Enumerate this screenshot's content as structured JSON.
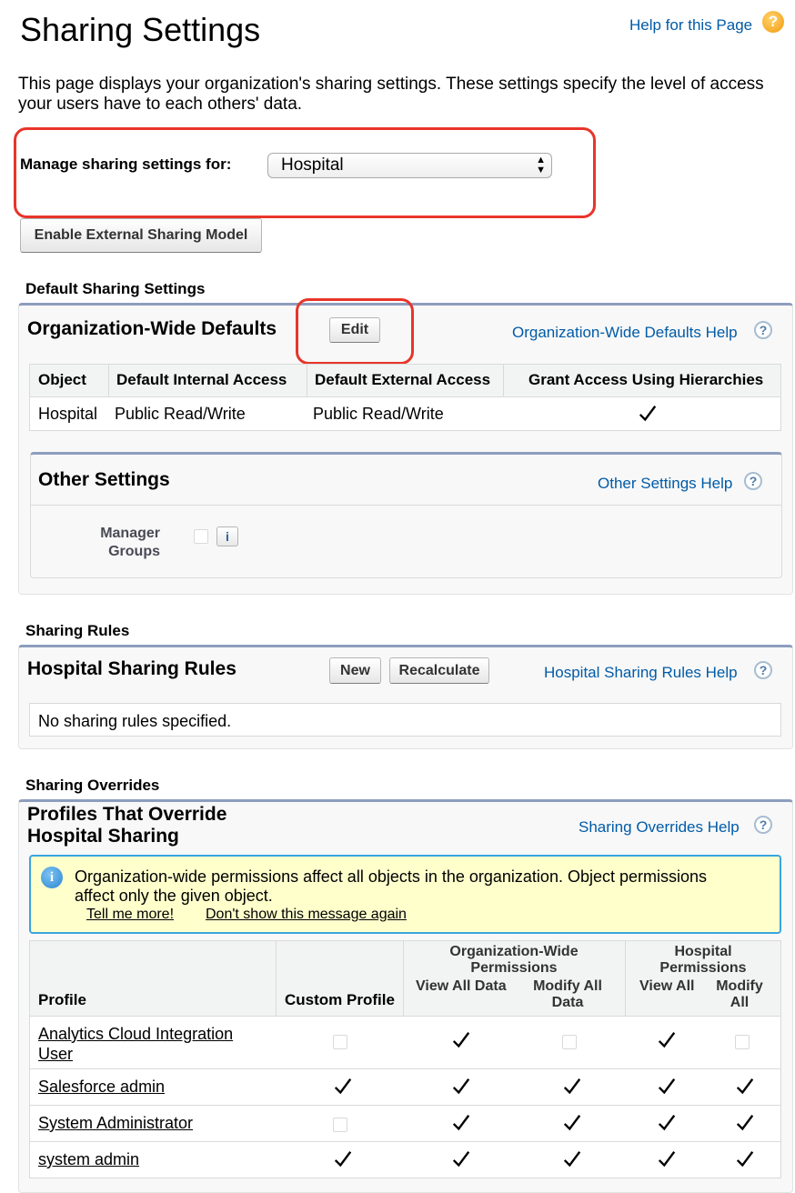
{
  "page": {
    "title": "Sharing Settings",
    "help_link": "Help for this Page",
    "description": "This page displays your organization's sharing settings. These settings specify the level of access your users have to each others' data."
  },
  "manage": {
    "label": "Manage sharing settings for:",
    "selected": "Hospital"
  },
  "enable_external_button": "Enable External Sharing Model",
  "default_sharing": {
    "section_title": "Default Sharing Settings",
    "owd_title": "Organization-Wide Defaults",
    "edit_button": "Edit",
    "owd_help": "Organization-Wide Defaults Help",
    "columns": [
      "Object",
      "Default Internal Access",
      "Default External Access",
      "Grant Access Using Hierarchies"
    ],
    "row": {
      "object": "Hospital",
      "internal": "Public Read/Write",
      "external": "Public Read/Write",
      "grant": true
    },
    "other_settings_title": "Other Settings",
    "other_settings_help": "Other Settings Help",
    "manager_groups_label_1": "Manager",
    "manager_groups_label_2": "Groups",
    "manager_groups_checked": false,
    "info_icon": "i"
  },
  "sharing_rules": {
    "section_title": "Sharing Rules",
    "panel_title": "Hospital Sharing Rules",
    "new_button": "New",
    "recalculate_button": "Recalculate",
    "help": "Hospital Sharing Rules Help",
    "empty_text": "No sharing rules specified."
  },
  "overrides": {
    "section_title": "Sharing Overrides",
    "panel_title_1": "Profiles That Override",
    "panel_title_2": "Hospital Sharing",
    "help": "Sharing Overrides Help",
    "info_text_1": "Organization-wide permissions affect all objects in the organization. Object permissions",
    "info_text_2": "affect only the given object.",
    "tell_me_more": "Tell me more!",
    "dont_show": "Don't show this message again",
    "headers": {
      "profile": "Profile",
      "custom_profile": "Custom Profile",
      "org_wide_1": "Organization-Wide",
      "org_wide_2": "Permissions",
      "view_all_data": "View All Data",
      "modify_all_data_1": "Modify All",
      "modify_all_data_2": "Data",
      "hospital_1": "Hospital",
      "hospital_2": "Permissions",
      "view_all": "View All",
      "modify_all_1": "Modify",
      "modify_all_2": "All"
    },
    "rows": [
      {
        "profile_1": "Analytics Cloud Integration",
        "profile_2": "User",
        "custom": false,
        "view_all_data": true,
        "modify_all_data": false,
        "view_all": true,
        "modify_all": false
      },
      {
        "profile_1": "Salesforce admin",
        "profile_2": "",
        "custom": true,
        "view_all_data": true,
        "modify_all_data": true,
        "view_all": true,
        "modify_all": true
      },
      {
        "profile_1": "System Administrator",
        "profile_2": "",
        "custom": false,
        "view_all_data": true,
        "modify_all_data": true,
        "view_all": true,
        "modify_all": true
      },
      {
        "profile_1": "system admin",
        "profile_2": "",
        "custom": true,
        "view_all_data": true,
        "modify_all_data": true,
        "view_all": true,
        "modify_all": true
      }
    ]
  },
  "colors": {
    "link": "#015ba7",
    "panel_border_top": "#8e9dbe",
    "highlight_red": "#e8352a",
    "info_bg": "#ffffcc",
    "info_border": "#39a5df"
  },
  "icons": {
    "help": "question-circle-icon",
    "checked": "checkmark-icon",
    "unchecked": "empty-checkbox-icon",
    "info": "info-circle-icon",
    "select": "updown-arrows-icon"
  }
}
